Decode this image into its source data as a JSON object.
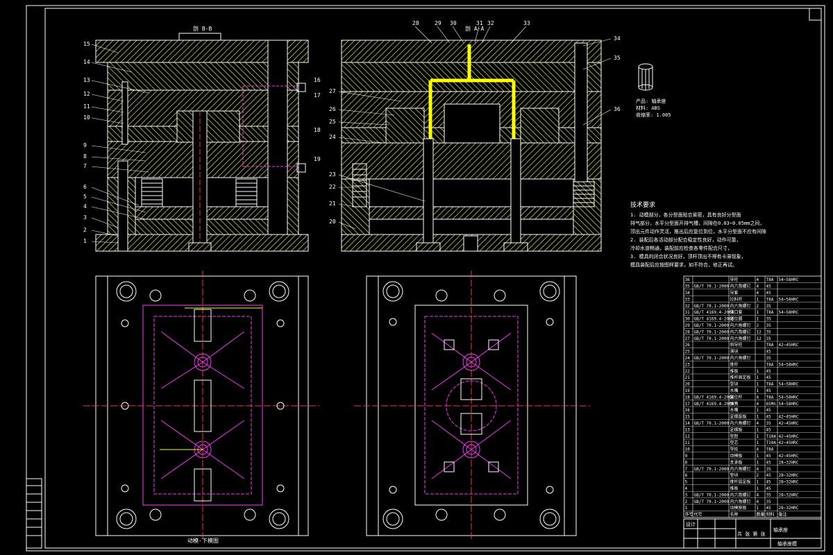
{
  "drawing": {
    "section_bb_label": "剖 B-B",
    "section_aa_label": "剖 A-A",
    "bottom_label": "动模-下模图",
    "left_part_numbers": [
      "15",
      "14",
      "13",
      "12",
      "11",
      "10",
      "9",
      "8",
      "7",
      "6",
      "5",
      "4",
      "3",
      "2",
      "1"
    ],
    "right_top_numbers": [
      "28",
      "29",
      "30",
      "31",
      "32",
      "33"
    ],
    "right_side_numbers": [
      "34",
      "35",
      "36"
    ],
    "middle_left_numbers": [
      "27",
      "26",
      "25",
      "24",
      "23",
      "22",
      "21",
      "20"
    ],
    "mid_right_numbers": [
      "16",
      "17",
      "18",
      "19"
    ]
  },
  "product_info": {
    "product": "产品: 轴承座",
    "material": "材料: ABS",
    "shrink": "收缩率: 1.005"
  },
  "tech_requirements": {
    "title": "技术要求",
    "items": [
      "1. 动模部分，各分型面贴合紧密，具有良好分型面",
      "排气部分，水平分型面开排气槽，间隙在0.03~0.05mm之间，",
      "顶出元件动作灵活，推出后应复位到位，水平分型面不应有间隙",
      "2. 装配后各活动部分配合稳定性良好，动作可靠，",
      "冷却水道畅通，装配前应检查各零件配合尺寸，",
      "3. 模具的闭合状况良好，顶杆顶出不得有卡滞现象，",
      "模具装配后应按图样要求，如不符合，修正再试。"
    ]
  },
  "bom_rows": [
    {
      "no": "36",
      "std": "",
      "name": "导柱",
      "mat": "T8A",
      "qty": "4",
      "note": "54~58HRC"
    },
    {
      "no": "35",
      "std": "GB/T 70.1-2000",
      "name": "内六角螺钉",
      "mat": "45",
      "qty": "4",
      "note": ""
    },
    {
      "no": "34",
      "std": "",
      "name": "导套",
      "mat": "45",
      "qty": "4",
      "note": ""
    },
    {
      "no": "33",
      "std": "",
      "name": "拉料杆",
      "mat": "T8A",
      "qty": "1",
      "note": "54~58HRC"
    },
    {
      "no": "32",
      "std": "GB/T 70.1-2000",
      "name": "内六角螺钉",
      "mat": "35",
      "qty": "2",
      "note": ""
    },
    {
      "no": "31",
      "std": "GB/T 4169.4-2006",
      "name": "浇口套",
      "mat": "T8A",
      "qty": "1",
      "note": "54~58HRC"
    },
    {
      "no": "30",
      "std": "GB/T 4169.4-2006",
      "name": "定位圈",
      "mat": "35",
      "qty": "1",
      "note": ""
    },
    {
      "no": "29",
      "std": "GB/T 70.1-2000",
      "name": "内六角螺钉",
      "mat": "35",
      "qty": "2",
      "note": ""
    },
    {
      "no": "28",
      "std": "GB/T 70.1-2000",
      "name": "内六角螺钉",
      "mat": "35",
      "qty": "12",
      "note": ""
    },
    {
      "no": "27",
      "std": "GB/T 70.1-2000",
      "name": "内六角螺钉",
      "mat": "35",
      "qty": "12",
      "note": ""
    },
    {
      "no": "26",
      "std": "",
      "name": "斜导柱",
      "mat": "T8A",
      "qty": "",
      "note": "42~45HRC"
    },
    {
      "no": "25",
      "std": "",
      "name": "滑块",
      "mat": "45",
      "qty": "",
      "note": ""
    },
    {
      "no": "24",
      "std": "GB/T 70.1-2000",
      "name": "内六角螺钉",
      "mat": "35",
      "qty": "",
      "note": ""
    },
    {
      "no": "23",
      "std": "",
      "name": "推杆",
      "mat": "T8A",
      "qty": "",
      "note": "54~58HRC"
    },
    {
      "no": "22",
      "std": "",
      "name": "推板",
      "mat": "45",
      "qty": "1",
      "note": ""
    },
    {
      "no": "21",
      "std": "",
      "name": "推杆固定板",
      "mat": "45",
      "qty": "1",
      "note": ""
    },
    {
      "no": "20",
      "std": "",
      "name": "垫块",
      "mat": "T8A",
      "qty": "1",
      "note": "54~58HRC"
    },
    {
      "no": "19",
      "std": "",
      "name": "水嘴",
      "mat": "45",
      "qty": "1",
      "note": ""
    },
    {
      "no": "18",
      "std": "GB/T 4169.4-2006",
      "name": "复位杆",
      "mat": "T8A",
      "qty": "4",
      "note": "54~58HRC"
    },
    {
      "no": "17",
      "std": "GB/T 4169.4-2006",
      "name": "弹簧",
      "mat": "65Mn",
      "qty": "4",
      "note": "54~58HRC"
    },
    {
      "no": "16",
      "std": "",
      "name": "水嘴",
      "mat": "45",
      "qty": "1",
      "note": ""
    },
    {
      "no": "15",
      "std": "",
      "name": "定模座板",
      "mat": "45",
      "qty": "1",
      "note": "42~45HRC"
    },
    {
      "no": "14",
      "std": "GB/T 70.1-2000",
      "name": "内六角螺钉",
      "mat": "35",
      "qty": "4",
      "note": "42~45HRC"
    },
    {
      "no": "13",
      "std": "",
      "name": "定模板",
      "mat": "45",
      "qty": "1",
      "note": ""
    },
    {
      "no": "12",
      "std": "",
      "name": "型腔",
      "mat": "T10A",
      "qty": "1",
      "note": "42~45HRC"
    },
    {
      "no": "11",
      "std": "",
      "name": "型芯",
      "mat": "T10A",
      "qty": "1",
      "note": "42~45HRC"
    },
    {
      "no": "10",
      "std": "",
      "name": "导柱",
      "mat": "T8A",
      "qty": "4",
      "note": ""
    },
    {
      "no": "9",
      "std": "",
      "name": "动模板",
      "mat": "45",
      "qty": "1",
      "note": "42~45HRC"
    },
    {
      "no": "8",
      "std": "",
      "name": "支承板",
      "mat": "45",
      "qty": "1",
      "note": "28~32HRC"
    },
    {
      "no": "7",
      "std": "GB/T 70.1-2000",
      "name": "内六角螺钉",
      "mat": "35",
      "qty": "4",
      "note": ""
    },
    {
      "no": "6",
      "std": "",
      "name": "垫块",
      "mat": "45",
      "qty": "2",
      "note": "28~32HRC"
    },
    {
      "no": "5",
      "std": "",
      "name": "推杆固定板",
      "mat": "45",
      "qty": "1",
      "note": "28~32HRC"
    },
    {
      "no": "4",
      "std": "",
      "name": "推板",
      "mat": "45",
      "qty": "1",
      "note": ""
    },
    {
      "no": "3",
      "std": "GB/T 70.1-2000",
      "name": "内六角螺钉",
      "mat": "35",
      "qty": "4",
      "note": "28~32HRC"
    },
    {
      "no": "2",
      "std": "GB/T 70.1-2000",
      "name": "内六角螺钉",
      "mat": "35",
      "qty": "4",
      "note": ""
    },
    {
      "no": "1",
      "std": "",
      "name": "动模座板",
      "mat": "45",
      "qty": "1",
      "note": "28~32HRC"
    }
  ],
  "bom_header": [
    "序号",
    "代号",
    "名称",
    "数量",
    "材料",
    "备注"
  ],
  "title_block": {
    "drawing_name": "轴承座",
    "designer_label": "设计",
    "sheet_label": "共 张 第 张",
    "company": "轴承座模"
  },
  "colors": {
    "background": "#000000",
    "hatch": "#ffff66",
    "outline": "#ffffff",
    "centerline": "#ff3333",
    "magenta": "#ff33ff",
    "highlight": "#ffff00"
  }
}
